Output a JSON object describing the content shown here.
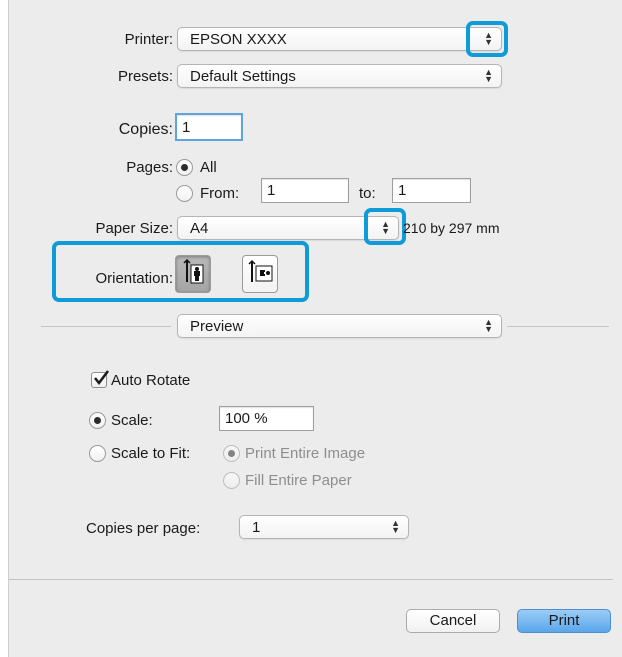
{
  "printer": {
    "label": "Printer:",
    "value": "EPSON XXXX"
  },
  "presets": {
    "label": "Presets:",
    "value": "Default Settings"
  },
  "copies": {
    "label": "Copies:",
    "value": "1"
  },
  "pages": {
    "label": "Pages:",
    "all_label": "All",
    "from_label": "From:",
    "from_value": "1",
    "to_label": "to:",
    "to_value": "1",
    "selected": "All"
  },
  "paper_size": {
    "label": "Paper Size:",
    "value": "A4",
    "dimensions": "210 by 297 mm"
  },
  "orientation": {
    "label": "Orientation:",
    "options": [
      "portrait",
      "landscape"
    ],
    "selected": "portrait"
  },
  "panel_selector": {
    "value": "Preview"
  },
  "auto_rotate": {
    "label": "Auto Rotate",
    "checked": true
  },
  "scale": {
    "label": "Scale:",
    "value": "100 %",
    "selected": true
  },
  "scale_to_fit": {
    "label": "Scale to Fit:",
    "print_entire_image_label": "Print Entire Image",
    "fill_entire_paper_label": "Fill Entire Paper"
  },
  "copies_per_page": {
    "label": "Copies per page:",
    "value": "1"
  },
  "footer": {
    "cancel_label": "Cancel",
    "print_label": "Print"
  },
  "colors": {
    "highlight": "#0f9ad8",
    "default_button": "#6fb3ee",
    "window_bg": "#ececec"
  }
}
